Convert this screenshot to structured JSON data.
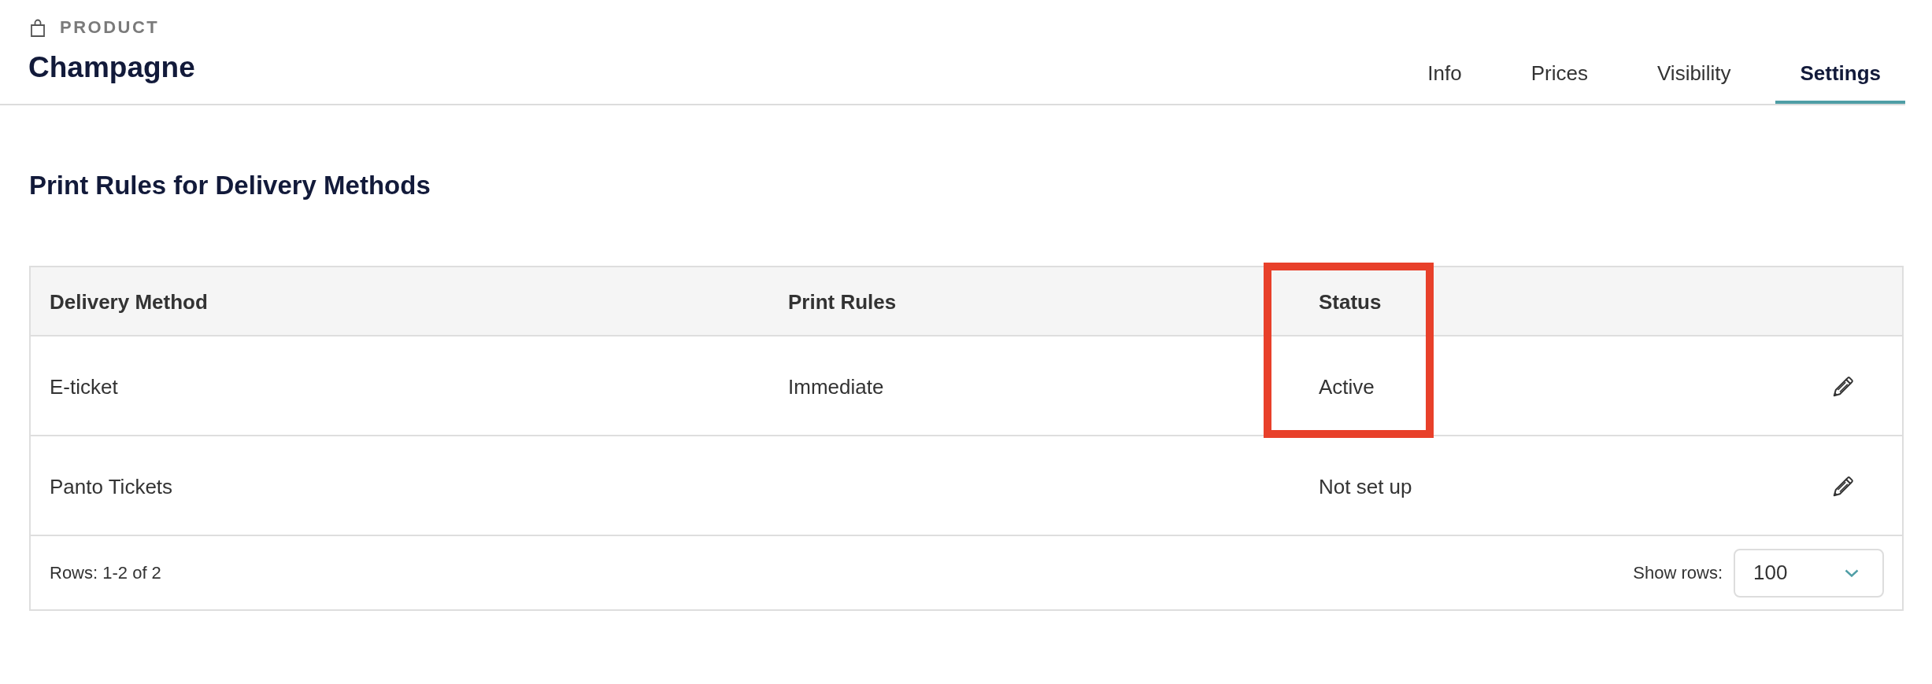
{
  "header": {
    "section_label": "PRODUCT",
    "title": "Champagne"
  },
  "tabs": [
    {
      "label": "Info",
      "selected": false
    },
    {
      "label": "Prices",
      "selected": false
    },
    {
      "label": "Visibility",
      "selected": false
    },
    {
      "label": "Settings",
      "selected": true
    }
  ],
  "section": {
    "heading": "Print Rules for Delivery Methods"
  },
  "table": {
    "columns": [
      {
        "label": "Delivery Method",
        "highlighted": false
      },
      {
        "label": "Print Rules",
        "highlighted": false
      },
      {
        "label": "Status",
        "highlighted": true
      }
    ],
    "rows": [
      {
        "delivery_method": "E-ticket",
        "print_rules": "Immediate",
        "status": "Active",
        "highlighted": true
      },
      {
        "delivery_method": "Panto Tickets",
        "status": "Not set up",
        "highlighted": false
      }
    ],
    "footer": {
      "row_count": "Rows: 1-2 of 2",
      "show_rows_label": "Show rows:",
      "page_size": "100"
    }
  }
}
